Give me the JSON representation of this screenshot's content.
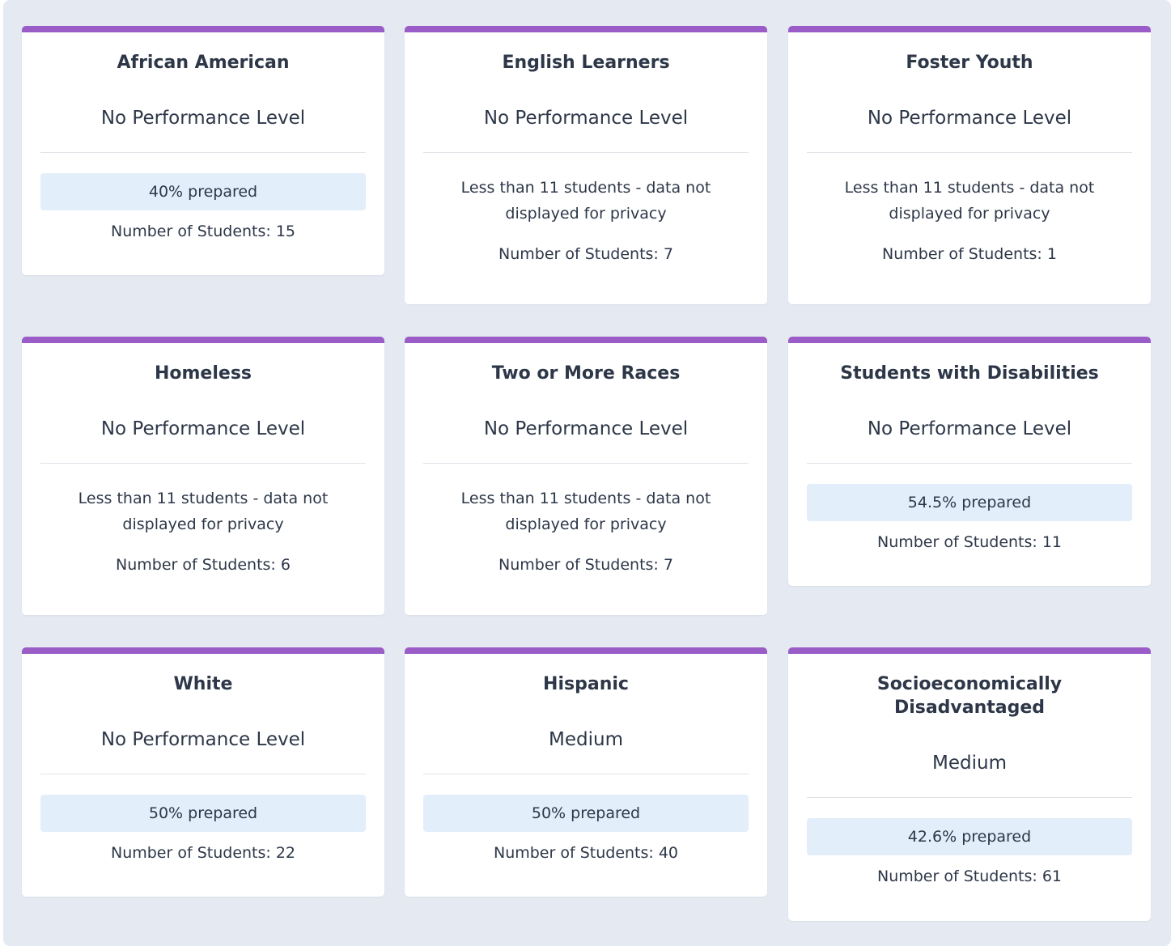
{
  "cards": [
    {
      "title": "African American",
      "level": "No Performance Level",
      "prepared": "40% prepared",
      "privacy": "",
      "count": "Number of Students: 15"
    },
    {
      "title": "English Learners",
      "level": "No Performance Level",
      "prepared": "",
      "privacy": "Less than 11 students - data not displayed for privacy",
      "count": "Number of Students: 7"
    },
    {
      "title": "Foster Youth",
      "level": "No Performance Level",
      "prepared": "",
      "privacy": "Less than 11 students - data not displayed for privacy",
      "count": "Number of Students: 1"
    },
    {
      "title": "Homeless",
      "level": "No Performance Level",
      "prepared": "",
      "privacy": "Less than 11 students - data not displayed for privacy",
      "count": "Number of Students: 6"
    },
    {
      "title": "Two or More Races",
      "level": "No Performance Level",
      "prepared": "",
      "privacy": "Less than 11 students - data not displayed for privacy",
      "count": "Number of Students: 7"
    },
    {
      "title": "Students with Disabilities",
      "level": "No Performance Level",
      "prepared": "54.5% prepared",
      "privacy": "",
      "count": "Number of Students: 11"
    },
    {
      "title": "White",
      "level": "No Performance Level",
      "prepared": "50% prepared",
      "privacy": "",
      "count": "Number of Students: 22"
    },
    {
      "title": "Hispanic",
      "level": "Medium",
      "prepared": "50% prepared",
      "privacy": "",
      "count": "Number of Students: 40"
    },
    {
      "title": "Socioeconomically Disadvantaged",
      "level": "Medium",
      "prepared": "42.6% prepared",
      "privacy": "",
      "count": "Number of Students: 61"
    }
  ],
  "colors": {
    "accent": "#9a5cc6",
    "panel": "#e5eaf2",
    "prepared_bg": "#e3eefb"
  }
}
